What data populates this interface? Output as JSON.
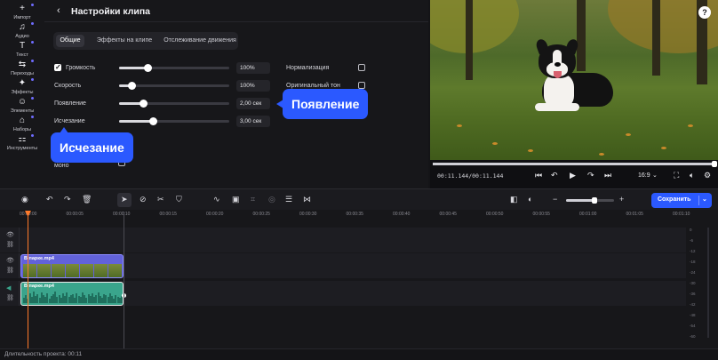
{
  "left_toolbar": {
    "items": [
      {
        "label": "Импорт",
        "icon": "plus-icon",
        "glyph": "+"
      },
      {
        "label": "Аудио",
        "icon": "music-icon",
        "glyph": "♫"
      },
      {
        "label": "Текст",
        "icon": "text-icon",
        "glyph": "T"
      },
      {
        "label": "Переходы",
        "icon": "transitions-icon",
        "glyph": "⇆"
      },
      {
        "label": "Эффекты",
        "icon": "effects-icon",
        "glyph": "✦"
      },
      {
        "label": "Элементы",
        "icon": "elements-icon",
        "glyph": "☺"
      },
      {
        "label": "Наборы",
        "icon": "sets-icon",
        "glyph": "⌂"
      },
      {
        "label": "Инструменты",
        "icon": "tools-icon",
        "glyph": "⚏"
      }
    ]
  },
  "settings": {
    "title": "Настройки клипа",
    "tabs": [
      "Общие",
      "Эффекты на клипе",
      "Отслеживание движения"
    ],
    "rows": [
      {
        "label": "Громкость",
        "value": "100%",
        "level": 0.26,
        "checked": true
      },
      {
        "label": "Скорость",
        "value": "100%",
        "level": 0.11
      },
      {
        "label": "Появление",
        "value": "2,00 сек",
        "level": 0.22
      },
      {
        "label": "Исчезание",
        "value": "3,00 сек",
        "level": 0.31
      }
    ],
    "right_options": [
      "Нормализация",
      "Оригинальный тон"
    ],
    "mono_label": "моно"
  },
  "callouts": {
    "appear": "Появление",
    "fade": "Исчезание"
  },
  "preview": {
    "timecode": "00:11.144/00:11.144",
    "aspect_ratio": "16:9",
    "progress": 1.0
  },
  "timeline": {
    "save_label": "Сохранить",
    "ruler_ticks": [
      "00:00:00",
      "00:00:05",
      "00:00:10",
      "00:00:15",
      "00:00:20",
      "00:00:25",
      "00:00:30",
      "00:00:35",
      "00:00:40",
      "00:00:45",
      "00:00:50",
      "00:00:55",
      "00:01:00",
      "00:01:05",
      "00:01:10"
    ],
    "video_clip_name": "В парке.mp4",
    "audio_clip_name": "В парке.mp4",
    "meter_labels": [
      "0",
      "-6",
      "-12",
      "-18",
      "-24",
      "-30",
      "-36",
      "-42",
      "-48",
      "-54",
      "-60"
    ]
  },
  "status": {
    "duration": "Длительность проекта: 00:11"
  },
  "colors": {
    "accent": "#2b59ff",
    "video_clip": "#6262d9",
    "audio_clip": "#3aa58c",
    "playhead": "#ff7a2a"
  }
}
